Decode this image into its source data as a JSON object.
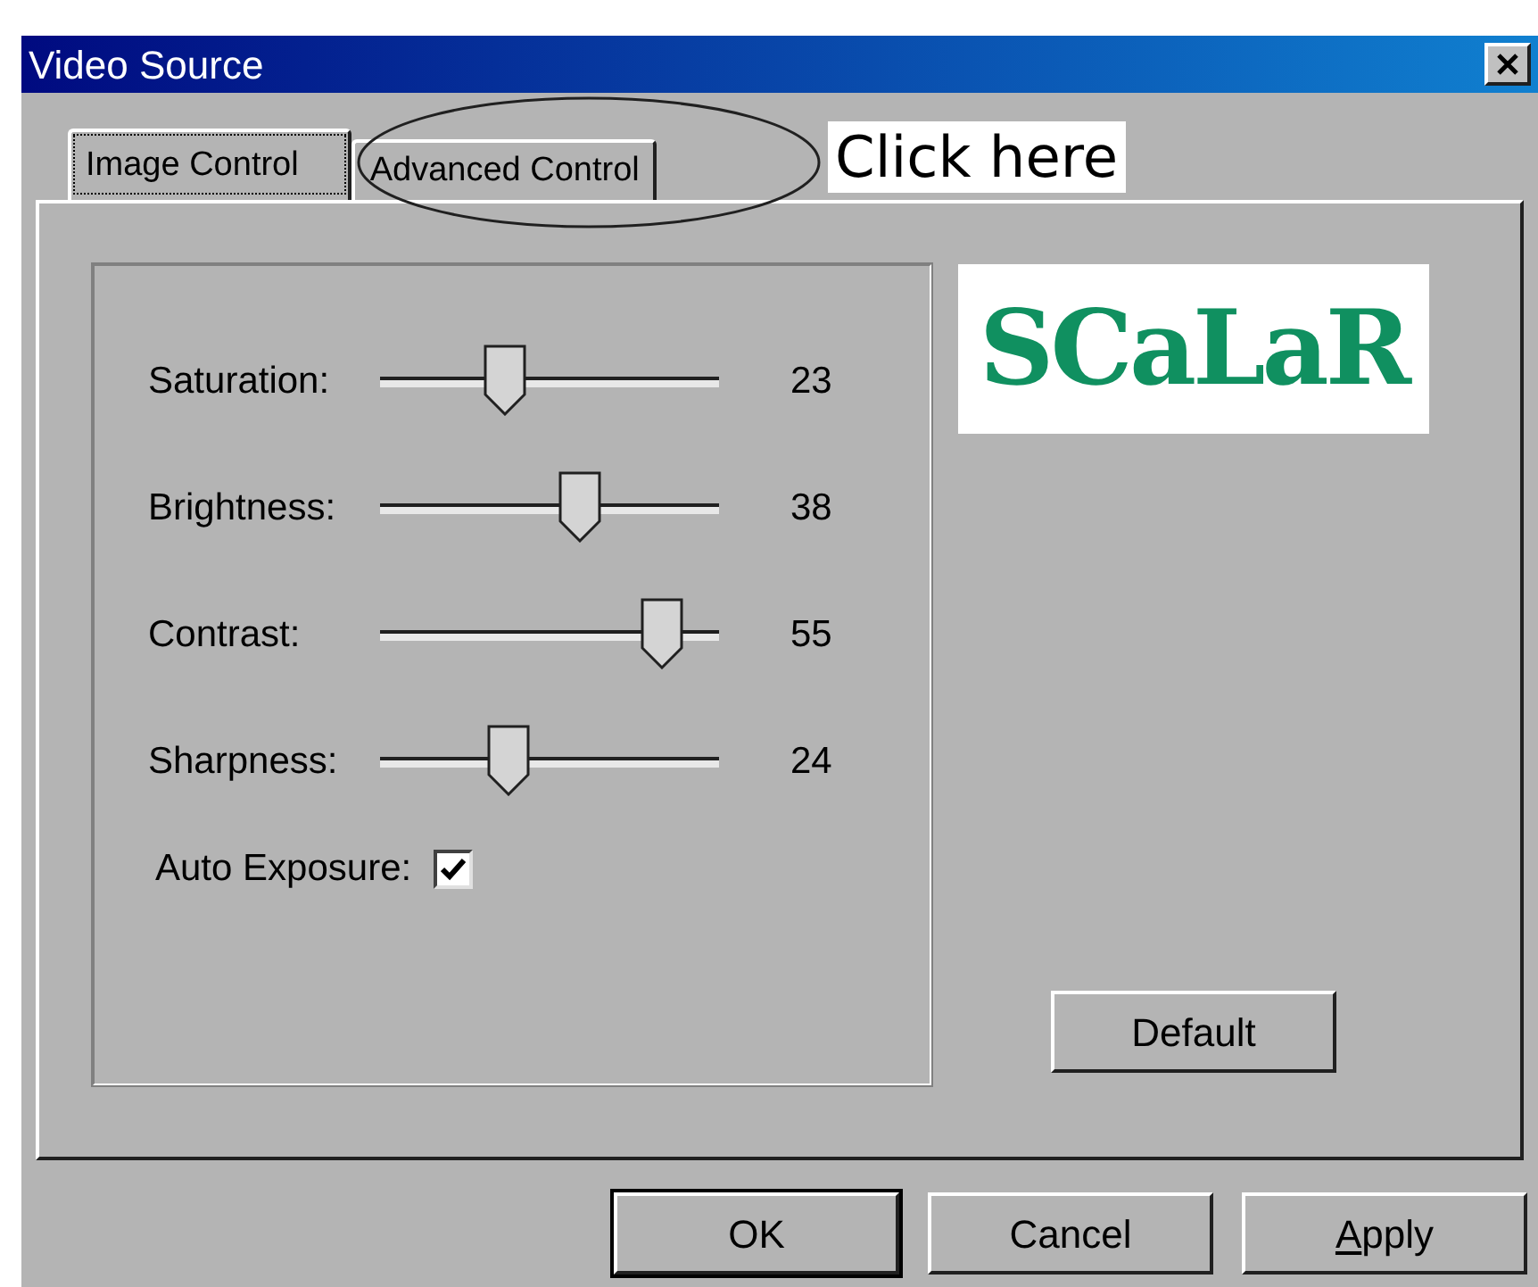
{
  "window": {
    "title": "Video Source"
  },
  "tabs": [
    {
      "label": "Image Control",
      "selected": true
    },
    {
      "label": "Advanced Control",
      "selected": false
    }
  ],
  "annotation": {
    "text": "Click here"
  },
  "sliders": [
    {
      "label": "Saturation:",
      "level": 0.37,
      "reading": "23"
    },
    {
      "label": "Brightness:",
      "level": 0.59,
      "reading": "38"
    },
    {
      "label": "Contrast:",
      "level": 0.83,
      "reading": "55"
    },
    {
      "label": "Sharpness:",
      "level": 0.38,
      "reading": "24"
    }
  ],
  "auto_exposure": {
    "label": "Auto Exposure:",
    "checked": true
  },
  "logo": {
    "text": "SCaLaR"
  },
  "default_button": {
    "label": "Default"
  },
  "buttons": [
    {
      "label": "OK",
      "default": true
    },
    {
      "label": "Cancel",
      "default": false
    },
    {
      "label": "Apply",
      "default": false,
      "underline_first": true
    }
  ]
}
